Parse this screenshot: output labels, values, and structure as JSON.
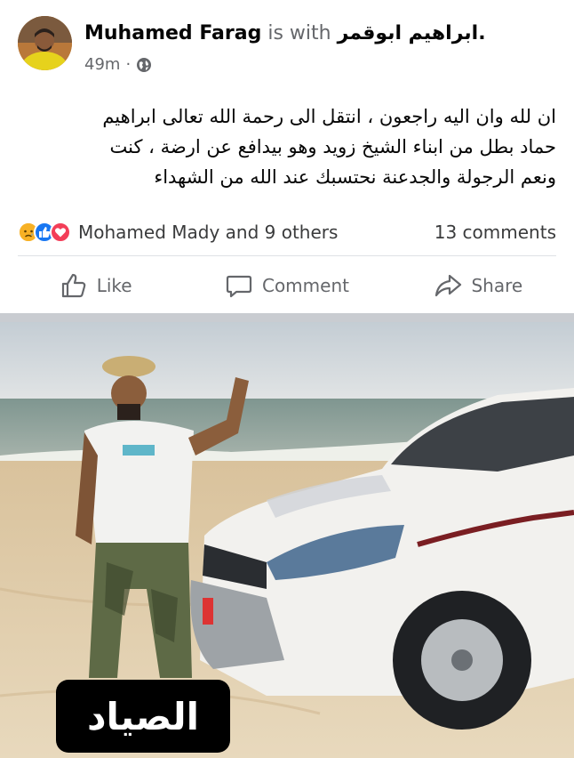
{
  "post": {
    "author": "Muhamed Farag",
    "with_text": " is with ",
    "tagged": "ابراهيم ابوقمر.",
    "time": "49m",
    "separator": "·",
    "privacy_icon": "globe-icon",
    "text": "ان لله وان اليه راجعون ، انتقل الى رحمة الله تعالى ابراهيم\nحماد  بطل من ابناء الشيخ زويد وهو بيدافع عن ارضة ، كنت\nونعم الرجولة والجدعنة نحتسبك عند الله من الشهداء"
  },
  "reactions": {
    "icons": [
      "sad-reaction-icon",
      "like-reaction-icon",
      "love-reaction-icon"
    ],
    "summary": "Mohamed Mady and 9 others",
    "comments": "13 comments"
  },
  "actions": {
    "like": "Like",
    "comment": "Comment",
    "share": "Share"
  },
  "photo": {
    "caption": "الصياد"
  },
  "colors": {
    "like_blue": "#1877f2",
    "love_red": "#f33e58",
    "sad_yellow": "#f7b125",
    "secondary_text": "#65676b"
  }
}
